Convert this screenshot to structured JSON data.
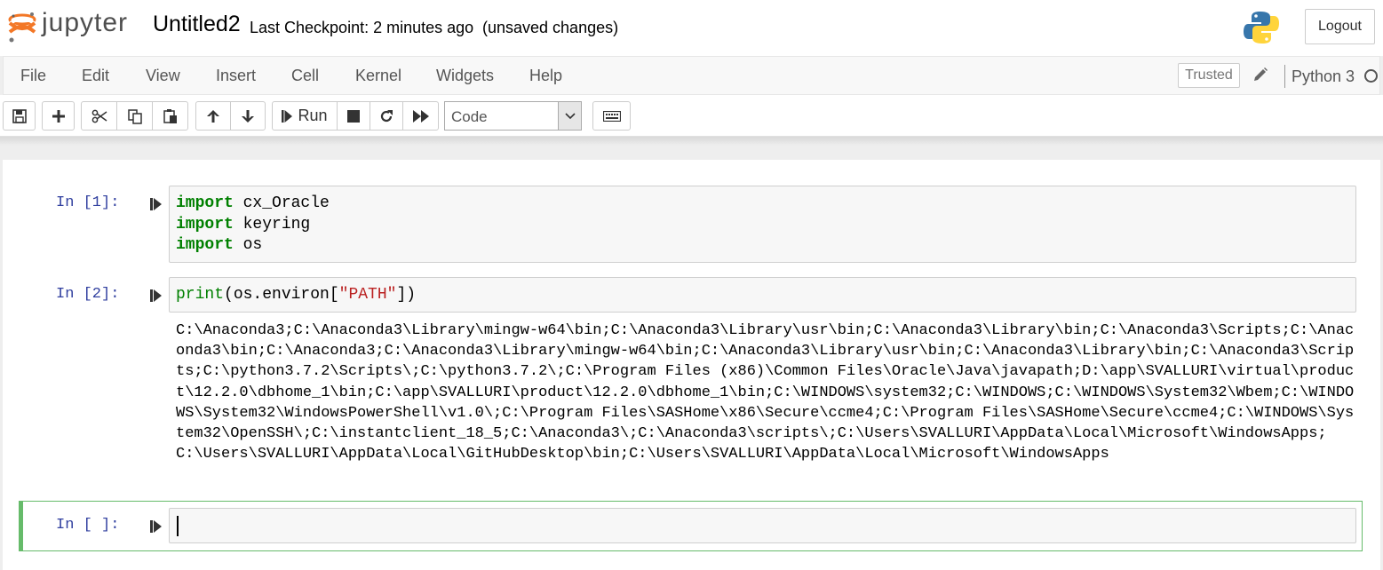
{
  "header": {
    "logo_text": "jupyter",
    "notebook_name": "Untitled2",
    "checkpoint": "Last Checkpoint: 2 minutes ago",
    "unsaved": "(unsaved changes)",
    "logout_label": "Logout"
  },
  "menubar": {
    "items": [
      "File",
      "Edit",
      "View",
      "Insert",
      "Cell",
      "Kernel",
      "Widgets",
      "Help"
    ],
    "trusted_label": "Trusted",
    "kernel_name": "Python 3"
  },
  "toolbar": {
    "run_label": "Run",
    "cell_type": "Code"
  },
  "cells": [
    {
      "prompt": "In [1]:",
      "lines": [
        {
          "kw": "import",
          "rest": " cx_Oracle"
        },
        {
          "kw": "import",
          "rest": " keyring"
        },
        {
          "kw": "import",
          "rest": " os"
        }
      ]
    },
    {
      "prompt": "In [2]:",
      "code": {
        "fn": "print",
        "pre": "(os.environ[",
        "str": "\"PATH\"",
        "post": "])"
      },
      "output": "C:\\Anaconda3;C:\\Anaconda3\\Library\\mingw-w64\\bin;C:\\Anaconda3\\Library\\usr\\bin;C:\\Anaconda3\\Library\\bin;C:\\Anaconda3\\Scripts;C:\\Anaconda3\\bin;C:\\Anaconda3;C:\\Anaconda3\\Library\\mingw-w64\\bin;C:\\Anaconda3\\Library\\usr\\bin;C:\\Anaconda3\\Library\\bin;C:\\Anaconda3\\Scripts;C:\\python3.7.2\\Scripts\\;C:\\python3.7.2\\;C:\\Program Files (x86)\\Common Files\\Oracle\\Java\\javapath;D:\\app\\SVALLURI\\virtual\\product\\12.2.0\\dbhome_1\\bin;C:\\app\\SVALLURI\\product\\12.2.0\\dbhome_1\\bin;C:\\WINDOWS\\system32;C:\\WINDOWS;C:\\WINDOWS\\System32\\Wbem;C:\\WINDOWS\\System32\\WindowsPowerShell\\v1.0\\;C:\\Program Files\\SASHome\\x86\\Secure\\ccme4;C:\\Program Files\\SASHome\\Secure\\ccme4;C:\\WINDOWS\\System32\\OpenSSH\\;C:\\instantclient_18_5;C:\\Anaconda3\\;C:\\Anaconda3\\scripts\\;C:\\Users\\SVALLURI\\AppData\\Local\\Microsoft\\WindowsApps;C:\\Users\\SVALLURI\\AppData\\Local\\GitHubDesktop\\bin;C:\\Users\\SVALLURI\\AppData\\Local\\Microsoft\\WindowsApps"
    },
    {
      "prompt": "In [ ]:"
    }
  ]
}
